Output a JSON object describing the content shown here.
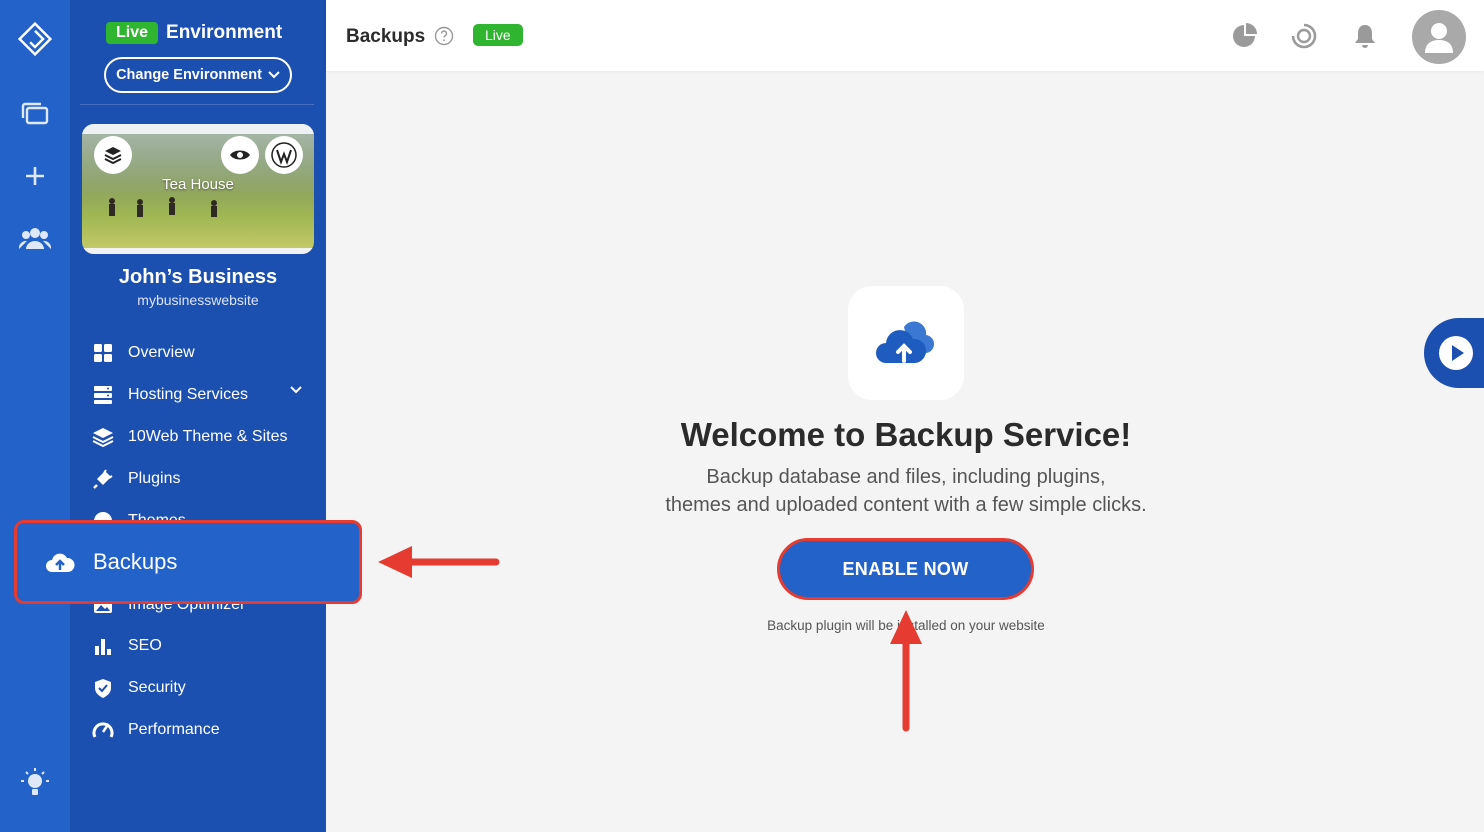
{
  "environment": {
    "badge": "Live",
    "label": "Environment",
    "change_button": "Change Environment"
  },
  "site": {
    "preview_title": "Tea House",
    "name": "John’s Business",
    "url": "mybusinesswebsite"
  },
  "sidebar": {
    "items": [
      {
        "label": "Overview",
        "icon": "grid-icon"
      },
      {
        "label": "Hosting Services",
        "icon": "server-icon"
      },
      {
        "label": "10Web Theme & Sites",
        "icon": "layers-icon"
      },
      {
        "label": "Plugins",
        "icon": "plug-icon"
      },
      {
        "label": "Themes",
        "icon": "palette-icon"
      },
      {
        "label": "Backups",
        "icon": "cloud-upload-icon"
      },
      {
        "label": "Image Optimizer",
        "icon": "image-icon"
      },
      {
        "label": "SEO",
        "icon": "bar-chart-icon"
      },
      {
        "label": "Security",
        "icon": "shield-icon"
      },
      {
        "label": "Performance",
        "icon": "gauge-icon"
      }
    ]
  },
  "header": {
    "title": "Backups",
    "badge": "Live"
  },
  "main": {
    "heading": "Welcome to Backup Service!",
    "description_line1": "Backup database and files, including plugins,",
    "description_line2": "themes and uploaded content with a few simple clicks.",
    "button": "ENABLE NOW",
    "note": "Backup plugin will be installed on your website"
  },
  "colors": {
    "sidebar": "#1b4fb0",
    "rail": "#2262c9",
    "live": "#2fb52f",
    "highlight": "#e53b30"
  }
}
